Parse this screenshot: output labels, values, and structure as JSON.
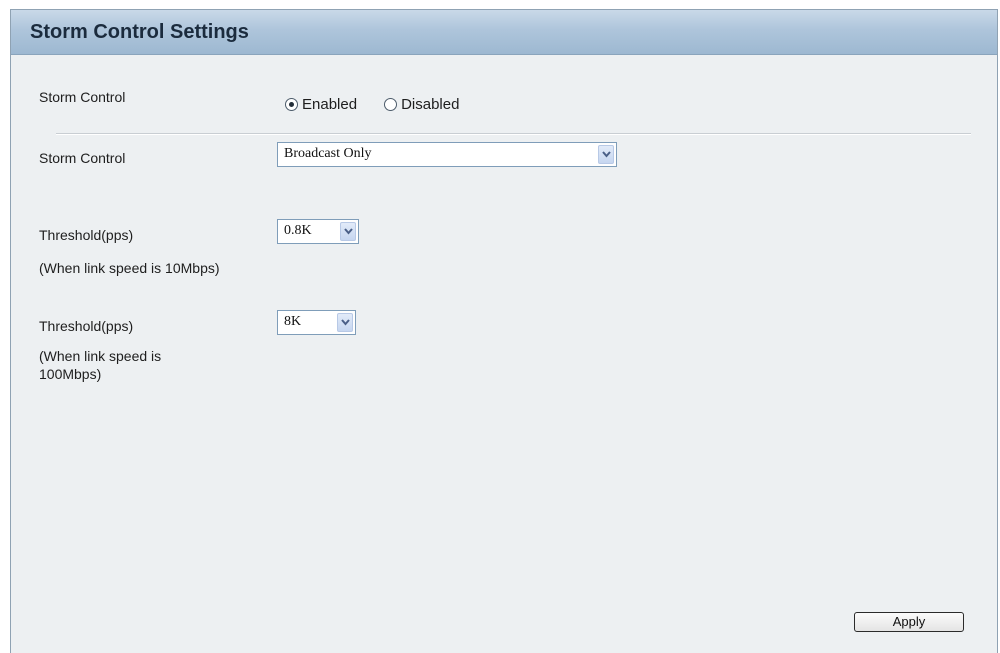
{
  "page": {
    "title": "Storm Control Settings"
  },
  "storm_control_state": {
    "label": "Storm Control",
    "options": [
      {
        "label": "Enabled",
        "checked": true
      },
      {
        "label": "Disabled",
        "checked": false
      }
    ]
  },
  "storm_control_type": {
    "label": "Storm Control",
    "selected": "Broadcast Only"
  },
  "threshold_10": {
    "label": "Threshold(pps)",
    "note": "(When link speed is 10Mbps)",
    "selected": "0.8K"
  },
  "threshold_100": {
    "label": "Threshold(pps)",
    "note_line1": "(When link speed is",
    "note_line2": "100Mbps)",
    "selected": "8K"
  },
  "actions": {
    "apply_label": "Apply"
  },
  "icons": {
    "dropdown": "chevron-down-icon",
    "radio_on": "radio-checked-icon",
    "radio_off": "radio-unchecked-icon"
  },
  "colors": {
    "title_bar": "#aec5db",
    "panel_background": "#edf0f2",
    "select_border": "#7f9db9"
  }
}
